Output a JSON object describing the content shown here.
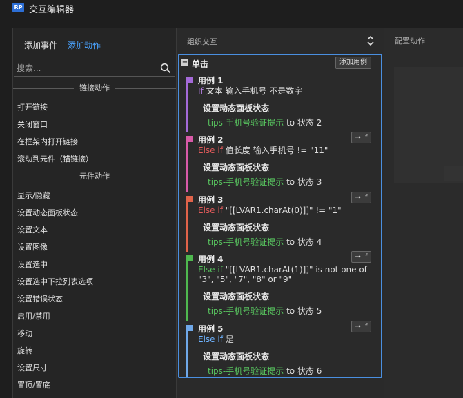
{
  "window": {
    "title": "交互编辑器",
    "logo": "RP"
  },
  "left": {
    "tabs": {
      "add_event": "添加事件",
      "add_action": "添加动作"
    },
    "search_placeholder": "搜索...",
    "sections": [
      {
        "title": "链接动作",
        "items": [
          "打开链接",
          "关闭窗口",
          "在框架内打开链接",
          "滚动到元件（锚链接）"
        ]
      },
      {
        "title": "元件动作",
        "items": [
          "显示/隐藏",
          "设置动态面板状态",
          "设置文本",
          "设置图像",
          "设置选中",
          "设置选中下拉列表选项",
          "设置错误状态",
          "启用/禁用",
          "移动",
          "旋转",
          "设置尺寸",
          "置顶/置底"
        ]
      }
    ]
  },
  "middle": {
    "title": "组织交互",
    "event": {
      "toggle": "−",
      "name": "单击",
      "add_case_label": "添加用例"
    },
    "cases": [
      {
        "name": "用例 1",
        "color": "#a46ad8",
        "cond_kw": "If",
        "cond_text": " 文本 输入手机号 不是数字",
        "action_title": "设置动态面板状态",
        "tips": "tips-手机号验证提示",
        "to_state": " to 状态 2",
        "btn": ""
      },
      {
        "name": "用例 2",
        "color": "#d85aa8",
        "cond_kw": "Else if",
        "cond_text": " 值长度 输入手机号 != \"11\"",
        "action_title": "设置动态面板状态",
        "tips": "tips-手机号验证提示",
        "to_state": " to 状态 3",
        "btn": "→ If"
      },
      {
        "name": "用例 3",
        "color": "#e0634a",
        "cond_kw": "Else if",
        "cond_text": " \"[[LVAR1.charAt(0)]]\" != \"1\"",
        "action_title": "设置动态面板状态",
        "tips": "tips-手机号验证提示",
        "to_state": " to 状态 4",
        "btn": "→ If"
      },
      {
        "name": "用例 4",
        "color": "#4fb84f",
        "cond_kw": "Else if",
        "cond_text": " \"[[LVAR1.charAt(1)]]\" is not one of \"3\", \"5\", \"7\", \"8\" or \"9\"",
        "action_title": "设置动态面板状态",
        "tips": "tips-手机号验证提示",
        "to_state": " to 状态 5",
        "btn": "→ If"
      },
      {
        "name": "用例 5",
        "color": "#6fa8e8",
        "cond_kw": "Else if",
        "cond_text": " 是",
        "action_title": "设置动态面板状态",
        "tips": "tips-手机号验证提示",
        "to_state": " to 状态 6",
        "btn": "→ If"
      }
    ]
  },
  "right": {
    "title": "配置动作"
  },
  "icons": {
    "logo": "rp-logo-icon",
    "search": "search-icon",
    "sort": "sort-arrows-icon"
  }
}
